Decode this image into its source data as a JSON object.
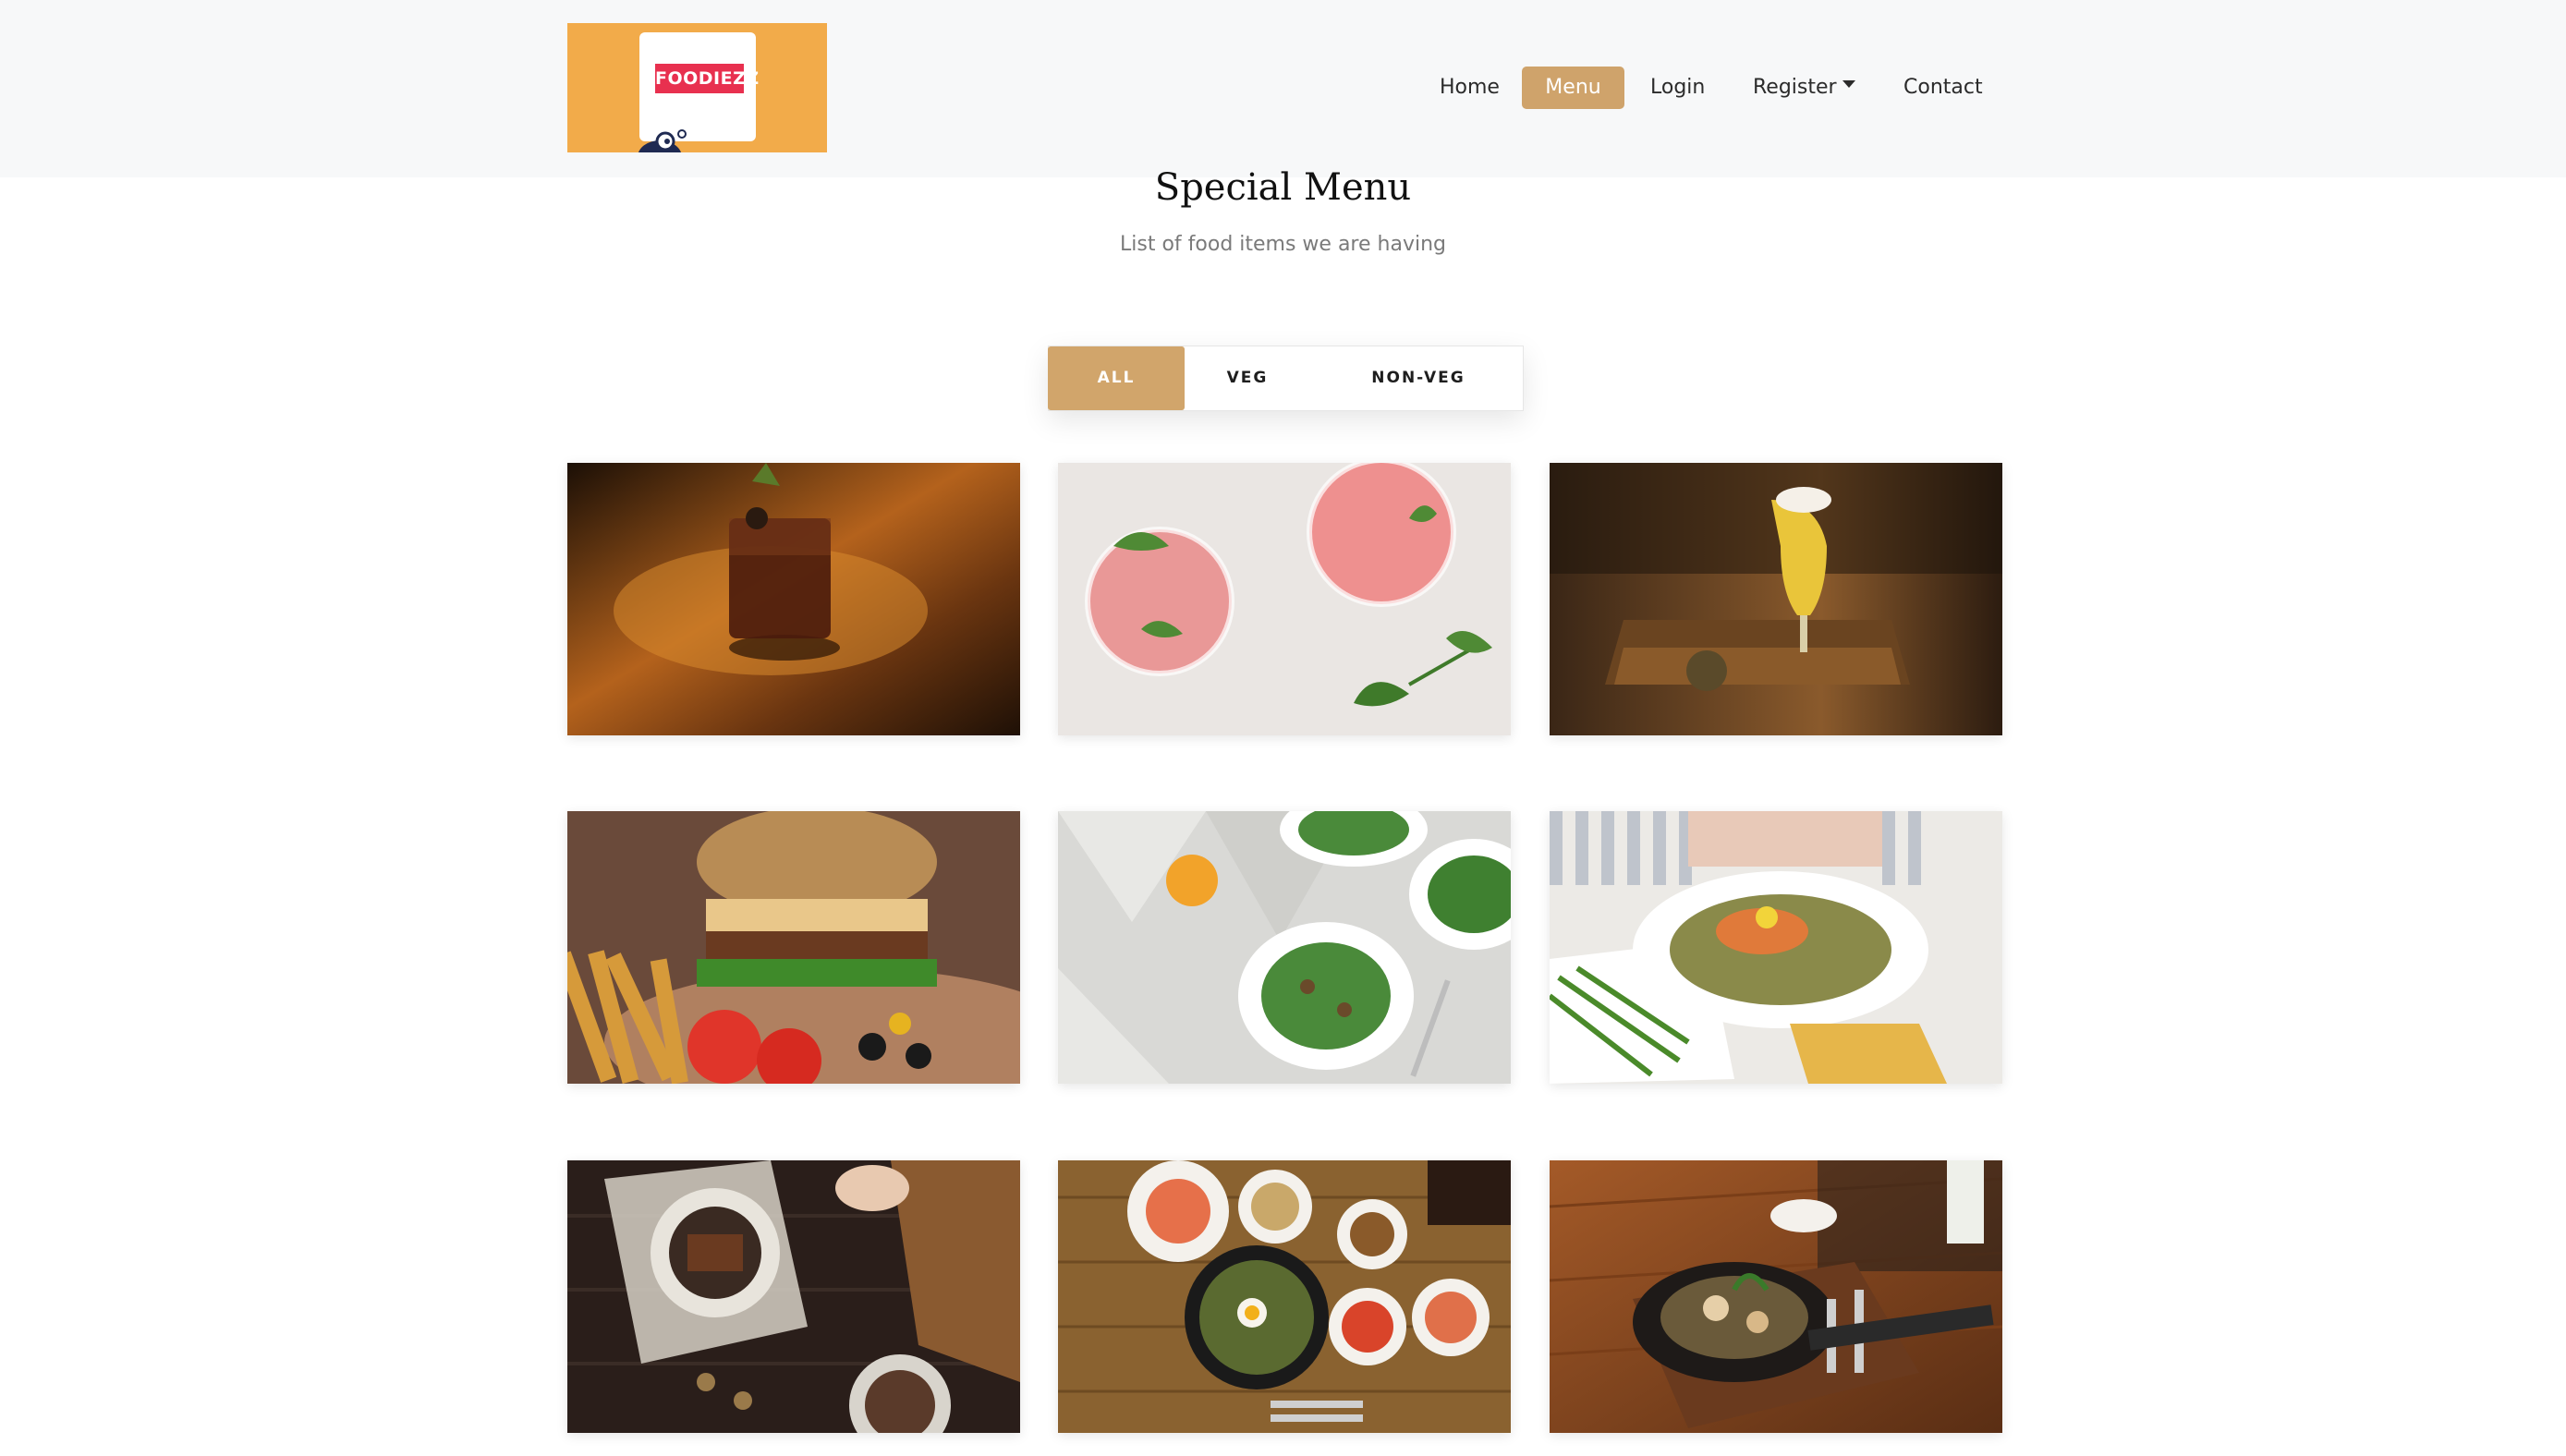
{
  "brand": {
    "logo_text": "FOODIEZZ",
    "logo_bg": "#f2ab4a",
    "logo_text_bg": "#e8304f"
  },
  "nav": {
    "items": [
      {
        "label": "Home",
        "active": false
      },
      {
        "label": "Menu",
        "active": true
      },
      {
        "label": "Login",
        "active": false
      },
      {
        "label": "Register",
        "active": false,
        "dropdown": true
      },
      {
        "label": "Contact",
        "active": false
      }
    ],
    "accent": "#cfa36b"
  },
  "section": {
    "title": "Special Menu",
    "subtitle": "List of food items we are having"
  },
  "filters": {
    "items": [
      {
        "label": "ALL",
        "active": true
      },
      {
        "label": "VEG",
        "active": false
      },
      {
        "label": "NON-VEG",
        "active": false
      }
    ]
  },
  "menu_images": [
    {
      "name": "cocktail-on-wooden-table-image"
    },
    {
      "name": "watermelon-mint-drinks-image"
    },
    {
      "name": "beer-glass-on-wooden-tray-image"
    },
    {
      "name": "burger-with-fries-image"
    },
    {
      "name": "green-salad-plates-image"
    },
    {
      "name": "salmon-with-green-beans-image"
    },
    {
      "name": "dark-table-dinner-spread-image"
    },
    {
      "name": "bibimbap-korean-meal-image"
    },
    {
      "name": "sizzling-skillet-dish-image"
    }
  ]
}
